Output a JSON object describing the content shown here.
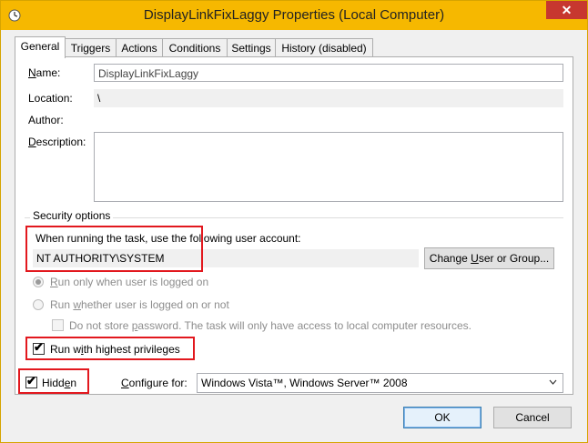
{
  "window": {
    "title": "DisplayLinkFixLaggy Properties (Local Computer)",
    "close_glyph": "✕",
    "accent": "#f6b800"
  },
  "tabs": [
    {
      "label": "General"
    },
    {
      "label": "Triggers"
    },
    {
      "label": "Actions"
    },
    {
      "label": "Conditions"
    },
    {
      "label": "Settings"
    },
    {
      "label": "History (disabled)"
    }
  ],
  "general": {
    "name_label_u": "N",
    "name_label_rest": "ame:",
    "name_value": "DisplayLinkFixLaggy",
    "location_label": "Location:",
    "location_value": "\\",
    "author_label": "Author:",
    "description_label_u": "D",
    "description_label_rest": "escription:",
    "description_value": ""
  },
  "security": {
    "group_label": "Security options",
    "account_prompt": "When running the task, use the following user account:",
    "account_value": "NT AUTHORITY\\SYSTEM",
    "change_user_button_pre": "Change ",
    "change_user_button_u": "U",
    "change_user_button_post": "ser or Group...",
    "radio_logged_on_u": "R",
    "radio_logged_on_rest": "un only when user is logged on",
    "radio_whether_pre": "Run ",
    "radio_whether_u": "w",
    "radio_whether_post": "hether user is logged on or not",
    "no_store_pre": "Do not store ",
    "no_store_u": "p",
    "no_store_post": "assword.  The task will only have access to local computer resources.",
    "highest_pre": "Run w",
    "highest_u": "i",
    "highest_post": "th highest privileges",
    "highest_checked": true
  },
  "footer": {
    "hidden_pre": "Hidd",
    "hidden_u": "e",
    "hidden_post": "n",
    "hidden_checked": true,
    "configure_label_u": "C",
    "configure_label_rest": "onfigure for:",
    "configure_value": "Windows Vista™, Windows Server™ 2008",
    "ok_label": "OK",
    "cancel_label": "Cancel"
  },
  "icons": {
    "window_icon": "task-scheduler-icon",
    "dropdown_icon": "chevron-down-icon",
    "check_glyph": "✔",
    "dropdown_glyph": "⌄"
  },
  "colors": {
    "highlight_red": "#e2181e"
  }
}
